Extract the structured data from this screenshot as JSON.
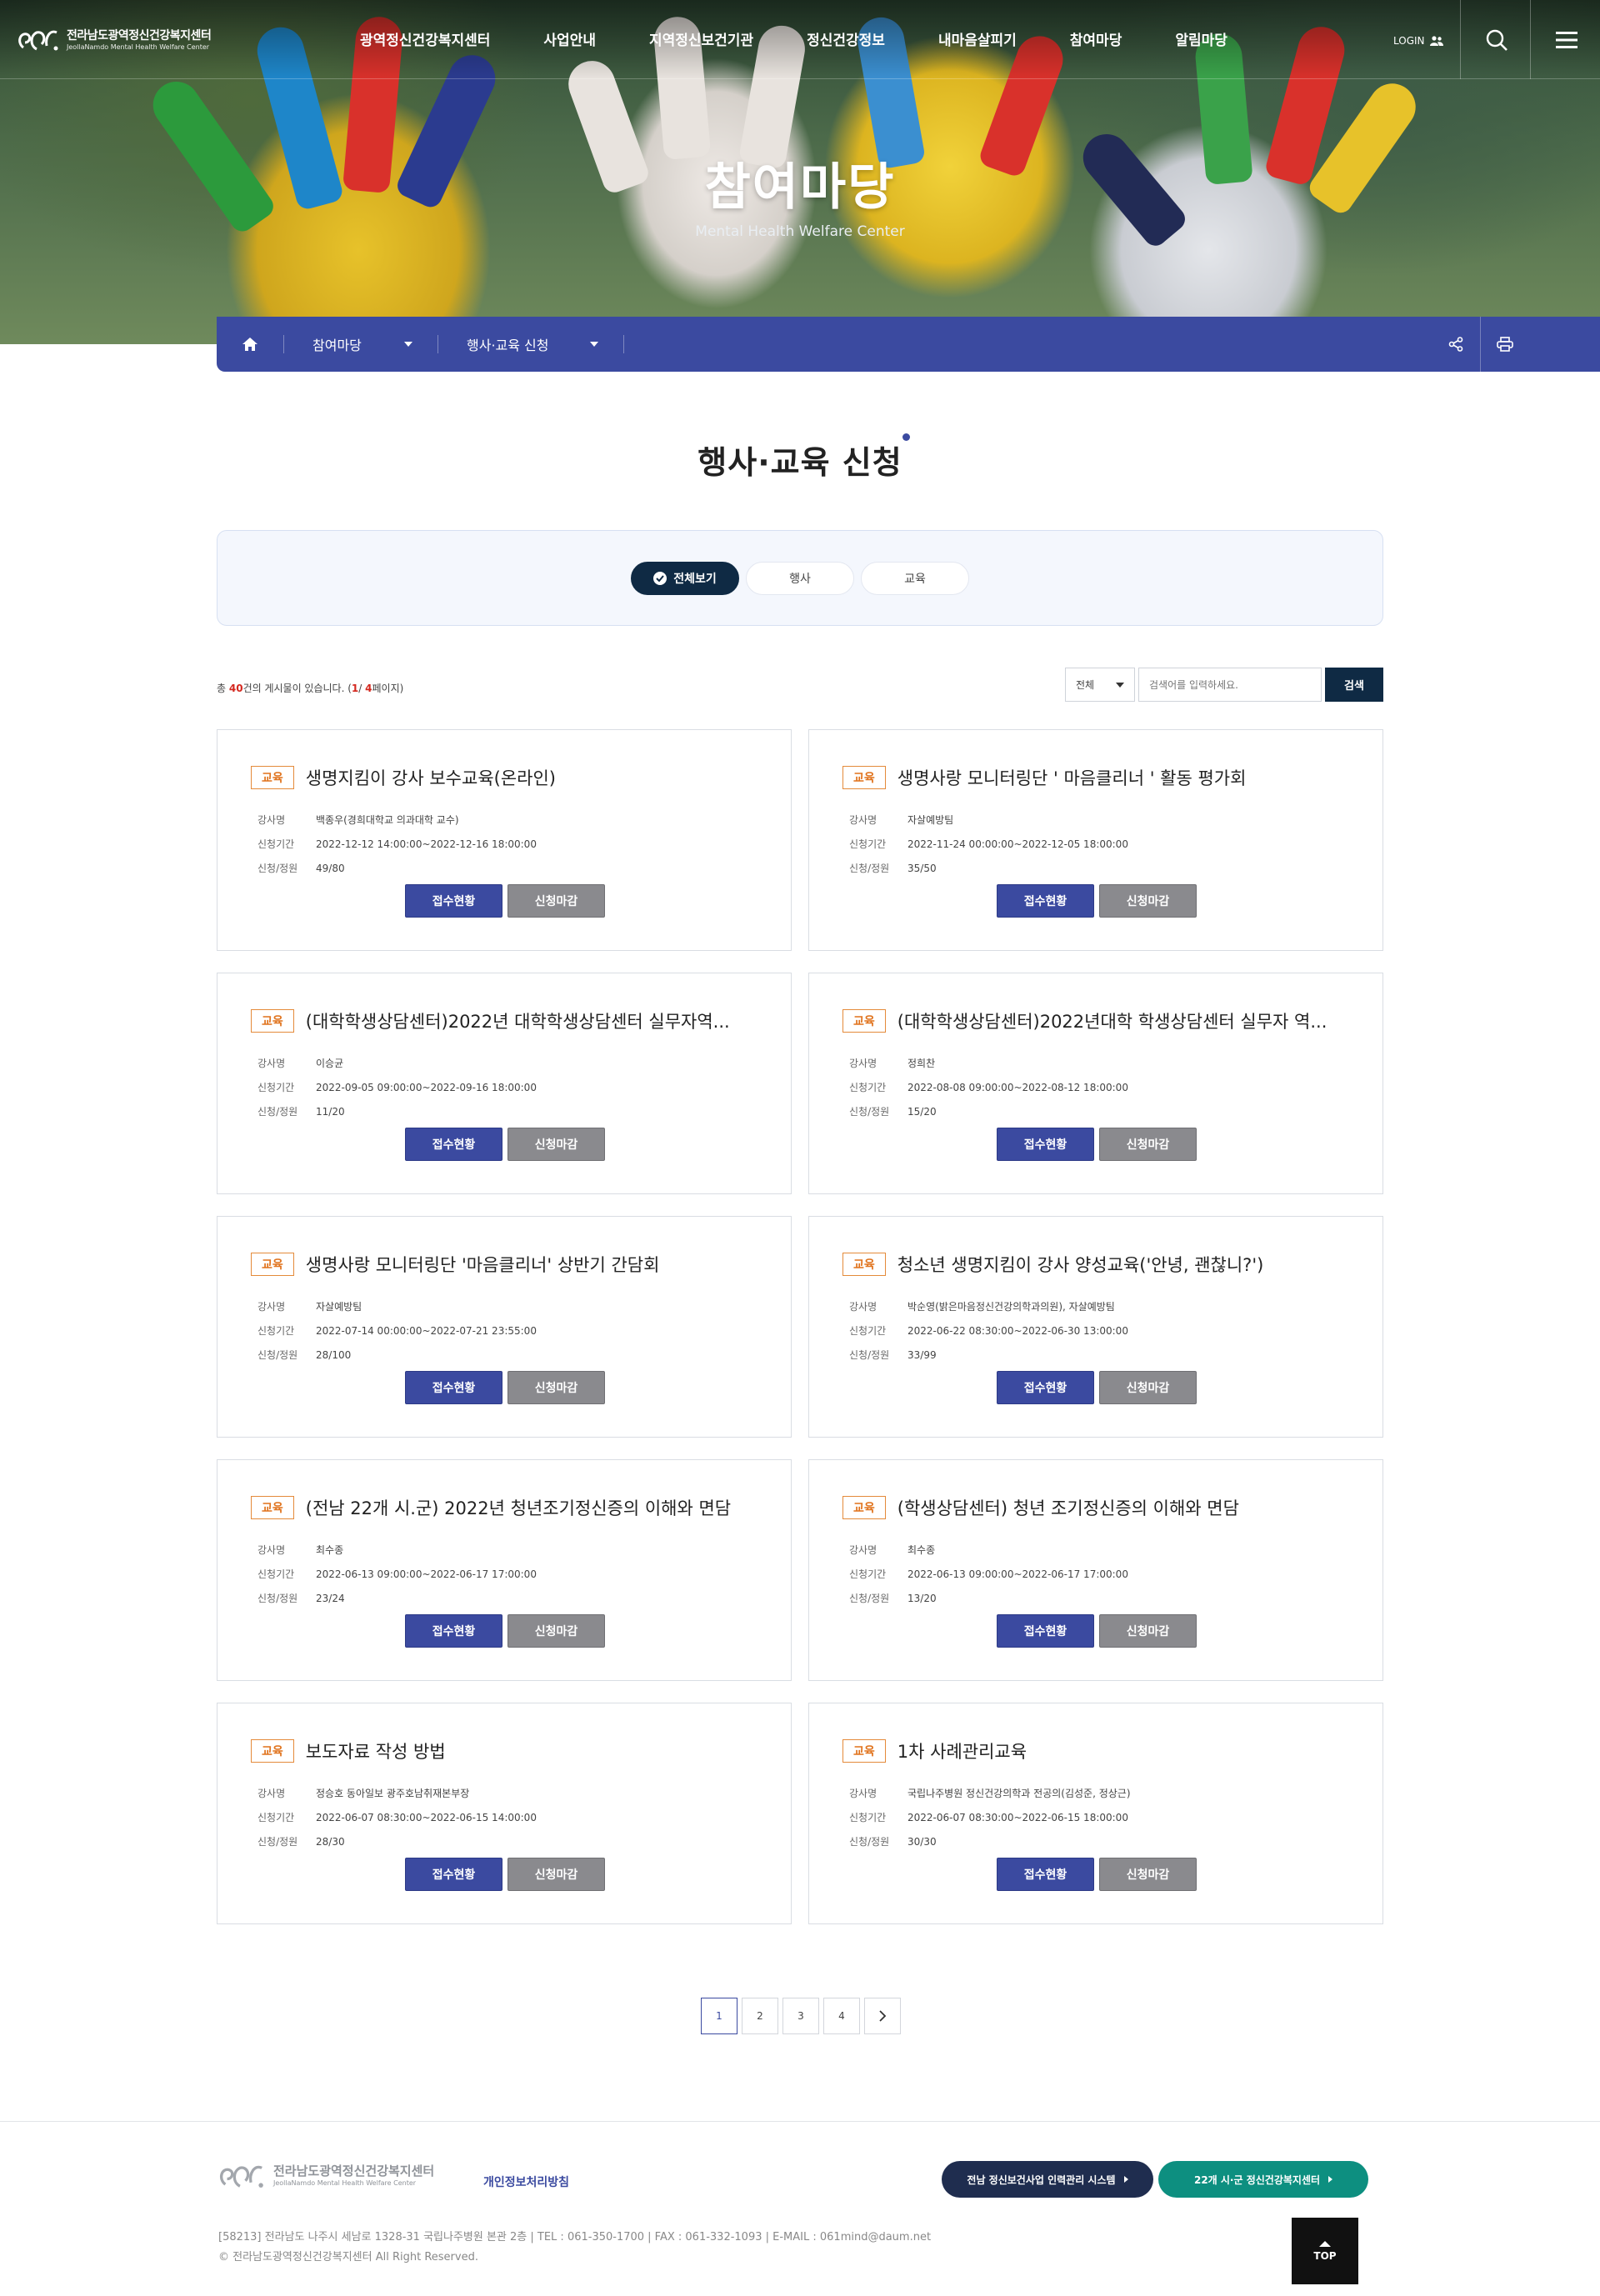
{
  "header": {
    "logo_kr": "전라남도광역정신건강복지센터",
    "logo_en": "JeollaNamdo Mental Health Welfare Center",
    "nav": [
      "광역정신건강복지센터",
      "사업안내",
      "지역정신보건기관",
      "정신건강정보",
      "내마음살피기",
      "참여마당",
      "알림마당"
    ],
    "login": "LOGIN",
    "icons": {
      "login": "user-group-icon",
      "search": "search-icon",
      "menu": "hamburger-icon"
    }
  },
  "hero": {
    "title": "참여마당",
    "subtitle": "Mental Health Welfare Center"
  },
  "subnav": {
    "home_icon": "home-icon",
    "menu1": "참여마당",
    "menu2": "행사·교육 신청",
    "share_icon": "share-icon",
    "print_icon": "print-icon"
  },
  "page_title": "행사·교육 신청",
  "tabs": [
    {
      "label": "전체보기",
      "active": true
    },
    {
      "label": "행사",
      "active": false
    },
    {
      "label": "교육",
      "active": false
    }
  ],
  "count": {
    "prefix": "총 ",
    "total": "40",
    "mid": "건의 게시물이 있습니다. (",
    "current": "1",
    "sep": "/ ",
    "pages": "4",
    "suffix": "페이지)"
  },
  "search": {
    "select": "전체",
    "placeholder": "검색어를 입력하세요.",
    "button": "검색"
  },
  "labels": {
    "instructor": "강사명",
    "period": "신청기간",
    "capacity": "신청/정원",
    "status_btn": "접수현황",
    "closed_btn": "신청마감"
  },
  "cards": [
    {
      "badge": "교육",
      "title": "생명지킴이 강사 보수교육(온라인)",
      "instructor": "백종우(경희대학교 의과대학 교수)",
      "period": "2022-12-12 14:00:00~2022-12-16 18:00:00",
      "capacity": "49/80"
    },
    {
      "badge": "교육",
      "title": "생명사랑 모니터링단 ' 마음클리너 ' 활동 평가회",
      "instructor": "자살예방팀",
      "period": "2022-11-24 00:00:00~2022-12-05 18:00:00",
      "capacity": "35/50"
    },
    {
      "badge": "교육",
      "title": "(대학학생상담센터)2022년 대학학생상담센터 실무자역...",
      "instructor": "이승균",
      "period": "2022-09-05 09:00:00~2022-09-16 18:00:00",
      "capacity": "11/20"
    },
    {
      "badge": "교육",
      "title": "(대학학생상담센터)2022년대학 학생상담센터 실무자 역...",
      "instructor": "정희찬",
      "period": "2022-08-08 09:00:00~2022-08-12 18:00:00",
      "capacity": "15/20"
    },
    {
      "badge": "교육",
      "title": "생명사랑 모니터링단 '마음클리너' 상반기 간담회",
      "instructor": "자살예방팀",
      "period": "2022-07-14 00:00:00~2022-07-21 23:55:00",
      "capacity": "28/100"
    },
    {
      "badge": "교육",
      "title": "청소년 생명지킴이 강사 양성교육('안녕, 괜찮니?')",
      "instructor": "박순영(밝은마음정신건강의학과의원), 자살예방팀",
      "period": "2022-06-22 08:30:00~2022-06-30 13:00:00",
      "capacity": "33/99"
    },
    {
      "badge": "교육",
      "title": "(전남 22개 시.군) 2022년 청년조기정신증의 이해와 면담",
      "instructor": "최수종",
      "period": "2022-06-13 09:00:00~2022-06-17 17:00:00",
      "capacity": "23/24"
    },
    {
      "badge": "교육",
      "title": "(학생상담센터) 청년 조기정신증의 이해와 면담",
      "instructor": "최수종",
      "period": "2022-06-13 09:00:00~2022-06-17 17:00:00",
      "capacity": "13/20"
    },
    {
      "badge": "교육",
      "title": "보도자료 작성 방법",
      "instructor": "정승호 동아일보 광주호남취재본부장",
      "period": "2022-06-07 08:30:00~2022-06-15 14:00:00",
      "capacity": "28/30"
    },
    {
      "badge": "교육",
      "title": "1차 사례관리교육",
      "instructor": "국립나주병원 정신건강의학과 전공의(김성준, 정상근)",
      "period": "2022-06-07 08:30:00~2022-06-15 18:00:00",
      "capacity": "30/30"
    }
  ],
  "pagination": {
    "pages": [
      "1",
      "2",
      "3",
      "4"
    ],
    "active": "1",
    "next_icon": "chevron-right-icon"
  },
  "footer": {
    "logo_kr": "전라남도광역정신건강복지센터",
    "logo_en": "JeollaNamdo Mental Health Welfare Center",
    "privacy": "개인정보처리방침",
    "btn1": "전남 정신보건사업 인력관리 시스템",
    "btn2": "22개 시·군 정신건강복지센터",
    "address": "[58213] 전라남도 나주시 세남로 1328-31 국립나주병원 본관 2층 | TEL : 061-350-1700 | FAX : 061-332-1093 | E-MAIL : 061mind@daum.net",
    "copyright": "© 전라남도광역정신건강복지센터 All Right Reserved.",
    "top": "TOP"
  },
  "colors": {
    "primary": "#3b4aa0",
    "navy": "#0f2a44",
    "badge": "#e0731d",
    "teal": "#0d8f80",
    "dark_btn": "#1f2d4f"
  }
}
